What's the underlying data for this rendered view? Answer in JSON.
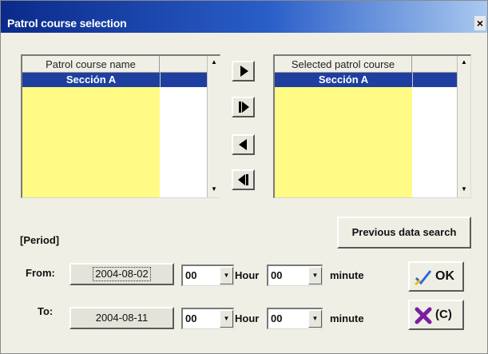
{
  "window": {
    "title": "Patrol course selection",
    "close_glyph": "×"
  },
  "available_list": {
    "header": "Patrol course name",
    "items": [
      "Sección A"
    ]
  },
  "selected_list": {
    "header": "Selected patrol course",
    "items": [
      "Sección A"
    ]
  },
  "transfer_buttons": {
    "add": "arrow-right-icon",
    "add_all": "arrow-right-all-icon",
    "remove": "arrow-left-icon",
    "remove_all": "arrow-left-all-icon"
  },
  "previous_search_label": "Previous data search",
  "period": {
    "heading": "[Period]",
    "from_label": "From:",
    "to_label": "To:",
    "from": {
      "date": "2004-08-02",
      "hour": "00",
      "minute": "00"
    },
    "to": {
      "date": "2004-08-11",
      "hour": "00",
      "minute": "00"
    },
    "hour_unit": "Hour",
    "minute_unit": "minute"
  },
  "actions": {
    "ok_label": "OK",
    "cancel_label": "(C)"
  },
  "colors": {
    "list_fill": "#fffb84",
    "selection": "#1f3fa0",
    "title_gradient_start": "#0a2a8a",
    "ok_check": "#2a6ad8",
    "cancel_x": "#7a1fa0"
  }
}
